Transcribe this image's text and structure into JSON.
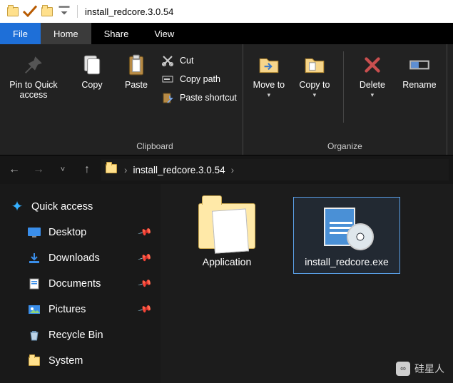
{
  "window": {
    "title": "install_redcore.3.0.54"
  },
  "tabs": {
    "file": "File",
    "home": "Home",
    "share": "Share",
    "view": "View"
  },
  "ribbon": {
    "pin": "Pin to Quick access",
    "copy": "Copy",
    "paste": "Paste",
    "cut": "Cut",
    "copypath": "Copy path",
    "pasteshortcut": "Paste shortcut",
    "moveto": "Move to",
    "copyto": "Copy to",
    "delete": "Delete",
    "rename": "Rename",
    "grp_clipboard": "Clipboard",
    "grp_organize": "Organize"
  },
  "address": {
    "crumb": "install_redcore.3.0.54"
  },
  "sidebar": {
    "quick": "Quick access",
    "desktop": "Desktop",
    "downloads": "Downloads",
    "documents": "Documents",
    "pictures": "Pictures",
    "recycle": "Recycle Bin",
    "system": "System"
  },
  "files": {
    "folder": "Application",
    "exe": "install_redcore.exe"
  },
  "watermark": {
    "label": "硅星人"
  }
}
